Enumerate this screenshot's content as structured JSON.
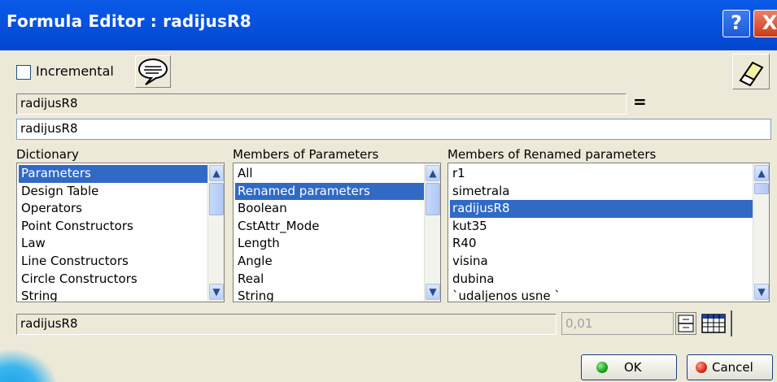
{
  "window": {
    "title": "Formula Editor : radijusR8",
    "help_label": "?",
    "close_label": "X"
  },
  "toolbar": {
    "incremental_label": "Incremental",
    "incremental_checked": false
  },
  "formula": {
    "parameter_name": "radijusR8",
    "equals_label": "=",
    "expression_value": "radijusR8"
  },
  "dictionary": {
    "label": "Dictionary",
    "items": [
      "Parameters",
      "Design Table",
      "Operators",
      "Point Constructors",
      "Law",
      "Line Constructors",
      "Circle Constructors",
      "String"
    ],
    "selected": "Parameters"
  },
  "members_of_parameters": {
    "label": "Members of Parameters",
    "items": [
      "All",
      "Renamed parameters",
      "Boolean",
      "CstAttr_Mode",
      "Length",
      "Angle",
      "Real",
      "String"
    ],
    "selected": "Renamed parameters"
  },
  "members_of_renamed": {
    "label": "Members of Renamed parameters",
    "items": [
      "r1",
      "simetrala",
      "radijusR8",
      "kut35",
      "R40",
      "visina",
      "dubina",
      "`udaljenos usne `"
    ],
    "selected": "radijusR8"
  },
  "bottom": {
    "selected_member": "radijusR8",
    "value": "0,01"
  },
  "buttons": {
    "ok_label": "OK",
    "cancel_label": "Cancel"
  },
  "colors": {
    "titlebar": "#0653e0",
    "selection": "#316ac5",
    "dialog_bg": "#ece9d8"
  }
}
